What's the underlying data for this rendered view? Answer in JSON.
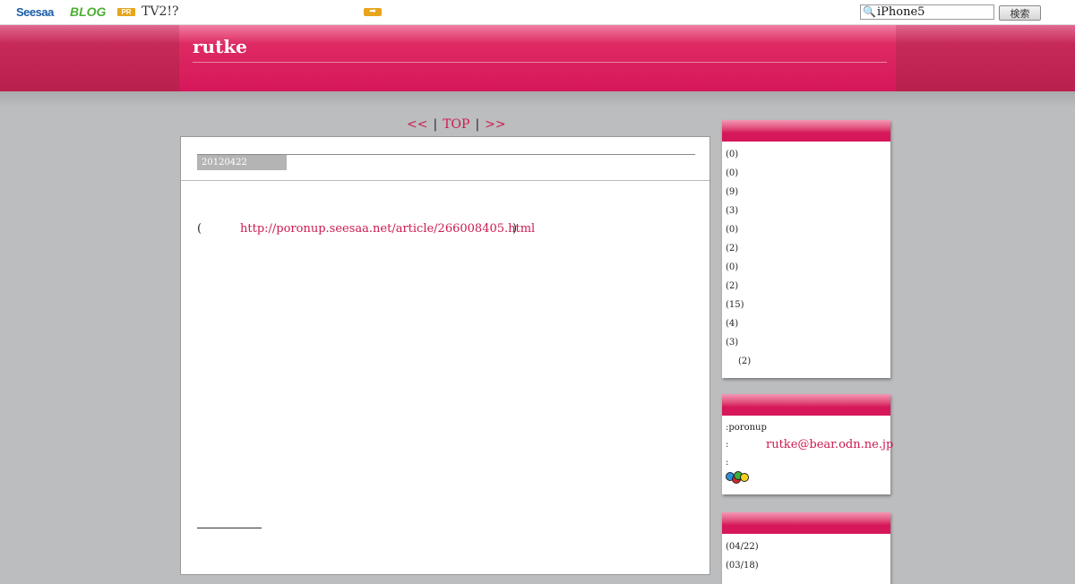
{
  "topbar": {
    "logo_seesaa": "Seesaa",
    "logo_blog": "BLOG",
    "pr_badge": "PR",
    "pr_text": "TV2!?",
    "search_value": "iPhone5",
    "search_button": "検索"
  },
  "header": {
    "title": "rutke"
  },
  "nav": {
    "prev": "<<",
    "sep1": "|",
    "top": "TOP",
    "sep2": "|",
    "next": ">>"
  },
  "article": {
    "date": "20120422",
    "open_paren": "(",
    "link": "http://poronup.seesaa.net/article/266008405.html",
    "close_paren": ")"
  },
  "sidebar": {
    "categories": [
      {
        "count": "(0)",
        "indent": false
      },
      {
        "count": "(0)",
        "indent": false
      },
      {
        "count": "(9)",
        "indent": false
      },
      {
        "count": "(3)",
        "indent": false
      },
      {
        "count": "(0)",
        "indent": false
      },
      {
        "count": "(2)",
        "indent": false
      },
      {
        "count": "(0)",
        "indent": false
      },
      {
        "count": "(2)",
        "indent": false
      },
      {
        "count": "(15)",
        "indent": false
      },
      {
        "count": "(4)",
        "indent": false
      },
      {
        "count": "(3)",
        "indent": false
      },
      {
        "count": "(2)",
        "indent": true
      }
    ],
    "profile": {
      "author": ":poronup",
      "mail_prefix": ":",
      "mail": "rutke@bear.odn.ne.jp",
      "third_prefix": ":"
    },
    "archives": [
      {
        "label": "(04/22)"
      },
      {
        "label": "(03/18)"
      }
    ]
  },
  "colors": {
    "accent": "#d6175a",
    "link": "#cc1a4f",
    "background": "#bcbdbf"
  }
}
